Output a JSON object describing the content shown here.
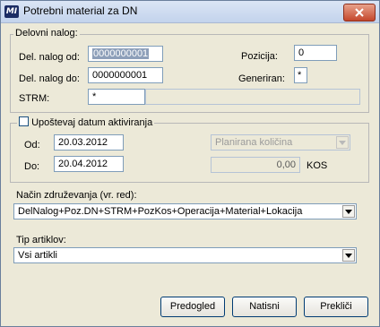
{
  "window": {
    "title": "Potrebni material za DN",
    "app_icon_text": "MI"
  },
  "delovni_nalog": {
    "legend": "Delovni nalog:",
    "od_label": "Del. nalog od:",
    "od_value": "0000000001",
    "do_label": "Del. nalog do:",
    "do_value": "0000000001",
    "pozicija_label": "Pozicija:",
    "pozicija_value": "0",
    "generiran_label": "Generiran:",
    "generiran_value": "*",
    "strm_label": "STRM:",
    "strm_value": "*",
    "strm_desc": ""
  },
  "datum": {
    "checkbox_label": "Upoštevaj datum aktiviranja",
    "checked": false,
    "od_label": "Od:",
    "od_value": "20.03.2012",
    "do_label": "Do:",
    "do_value": "20.04.2012",
    "kolicina_select": "Planirana količina",
    "kolicina_value": "0,00",
    "unit": "KOS"
  },
  "nacin": {
    "label": "Način združevanja (vr. red):",
    "value": "DelNalog+Poz.DN+STRM+PozKos+Operacija+Material+Lokacija"
  },
  "tip": {
    "label": "Tip artiklov:",
    "value": "Vsi artikli"
  },
  "buttons": {
    "preview": "Predogled",
    "print": "Natisni",
    "cancel": "Prekliči"
  }
}
